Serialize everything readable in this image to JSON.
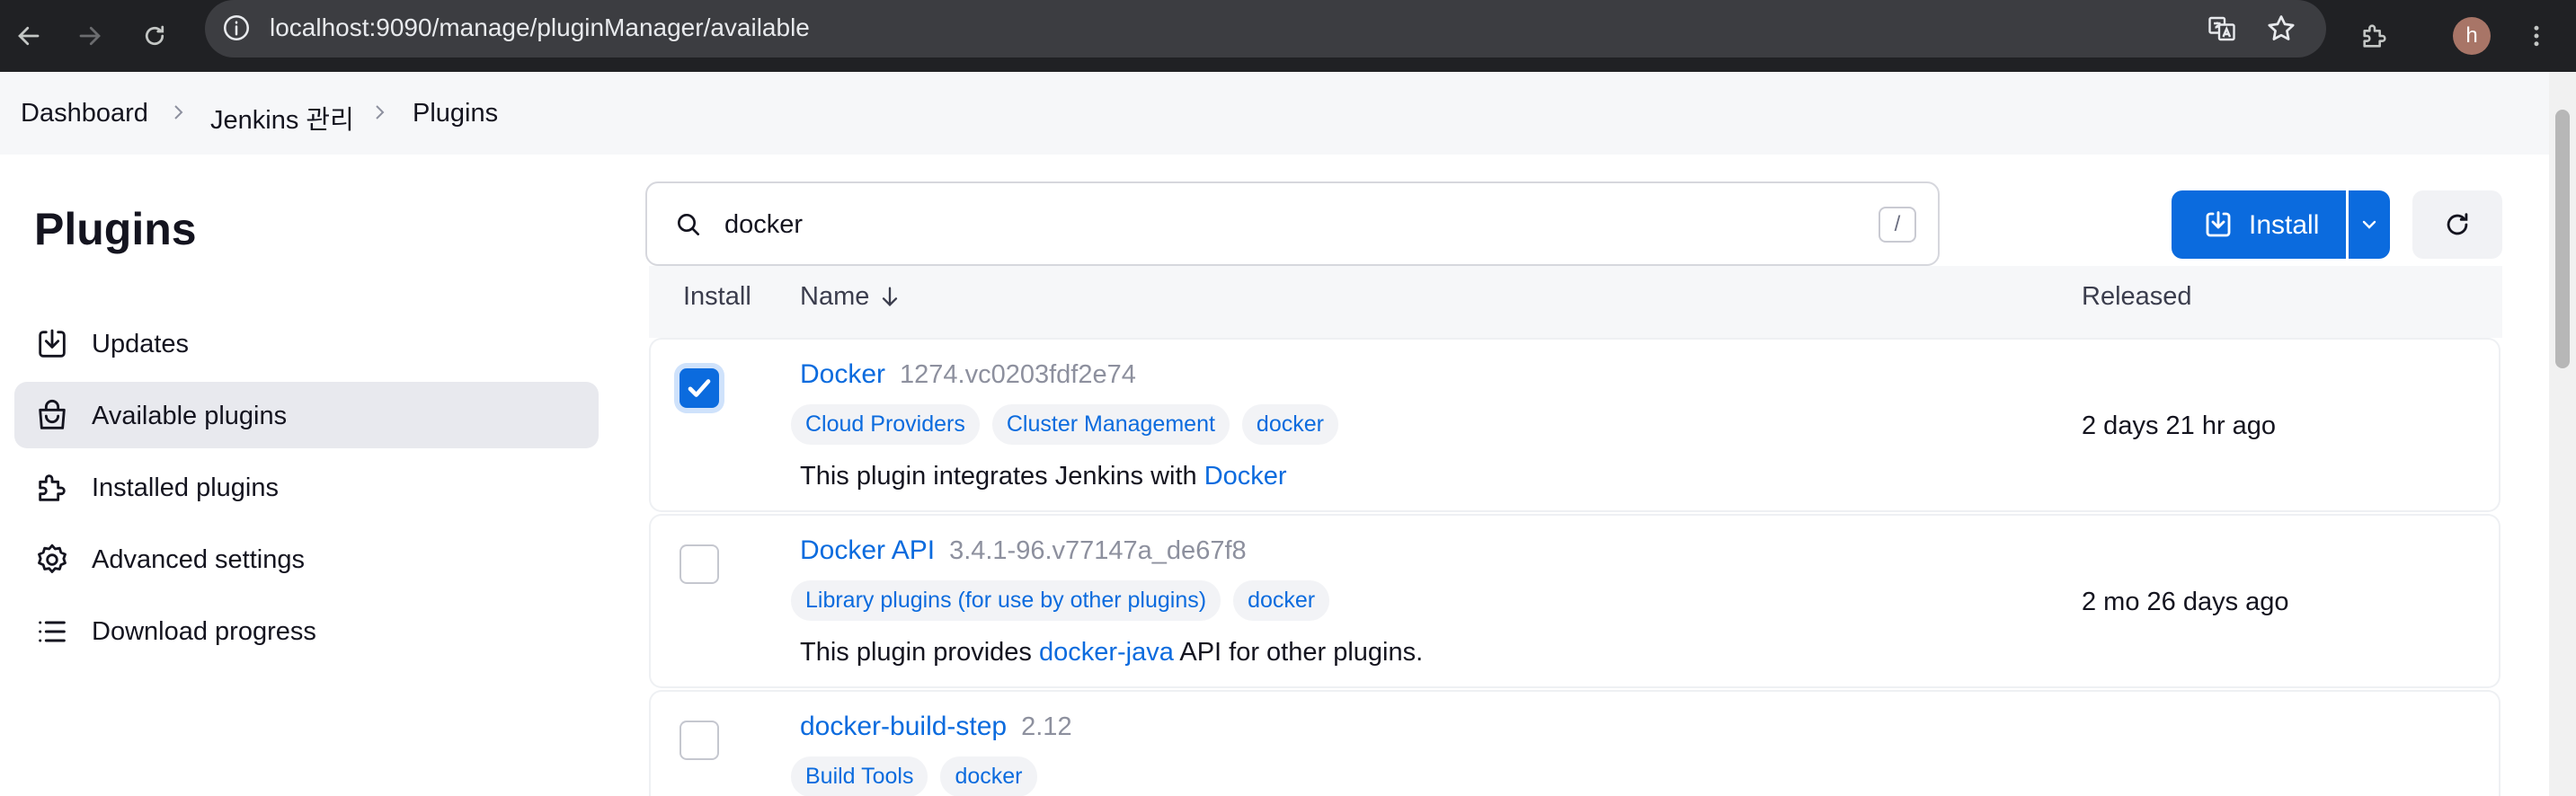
{
  "browser": {
    "url": "localhost:9090/manage/pluginManager/available",
    "avatar_initial": "h"
  },
  "breadcrumb": [
    "Dashboard",
    "Jenkins 관리",
    "Plugins"
  ],
  "sidebar": {
    "title": "Plugins",
    "items": [
      {
        "label": "Updates",
        "icon": "download-icon",
        "active": false
      },
      {
        "label": "Available plugins",
        "icon": "shopping-bag-icon",
        "active": true
      },
      {
        "label": "Installed plugins",
        "icon": "puzzle-icon",
        "active": false
      },
      {
        "label": "Advanced settings",
        "icon": "gear-icon",
        "active": false
      },
      {
        "label": "Download progress",
        "icon": "list-icon",
        "active": false
      }
    ]
  },
  "search": {
    "value": "docker",
    "shortcut": "/"
  },
  "actions": {
    "install_label": "Install"
  },
  "table": {
    "headers": {
      "install": "Install",
      "name": "Name",
      "released": "Released"
    },
    "rows": [
      {
        "name": "Docker",
        "version": "1274.vc0203fdf2e74",
        "tags": [
          "Cloud Providers",
          "Cluster Management",
          "docker"
        ],
        "desc_pre": "This plugin integrates Jenkins with ",
        "desc_link": "Docker",
        "desc_post": "",
        "released": "2 days 21 hr ago",
        "checked": true
      },
      {
        "name": "Docker API",
        "version": "3.4.1-96.v77147a_de67f8",
        "tags": [
          "Library plugins (for use by other plugins)",
          "docker"
        ],
        "desc_pre": "This plugin provides ",
        "desc_link": "docker-java",
        "desc_post": " API for other plugins.",
        "released": "2 mo 26 days ago",
        "checked": false
      },
      {
        "name": "docker-build-step",
        "version": "2.12",
        "tags": [
          "Build Tools",
          "docker"
        ],
        "desc_pre": "",
        "desc_link": "",
        "desc_post": "",
        "released": "",
        "checked": false
      }
    ]
  },
  "colors": {
    "accent": "#0b6bde",
    "chrome": "#202124",
    "crumb_bg": "#f6f7f9"
  }
}
